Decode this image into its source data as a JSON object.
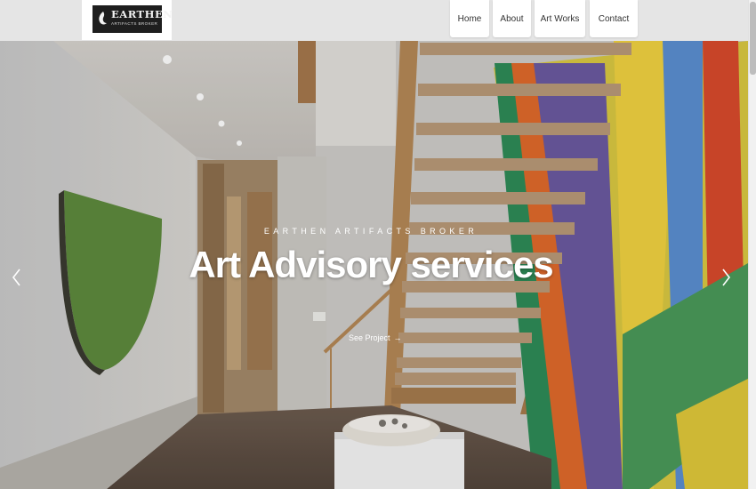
{
  "brand": {
    "logo_title": "EARTHEN",
    "logo_subtitle": "ARTIFACTS BROKER"
  },
  "nav": {
    "items": [
      {
        "label": "Home"
      },
      {
        "label": "About"
      },
      {
        "label": "Art Works"
      },
      {
        "label": "Contact"
      }
    ]
  },
  "hero": {
    "kicker": "EARTHEN ARTIFACTS BROKER",
    "title": "Art Advisory services",
    "cta_label": "See Project",
    "cta_icon": "arrow-right-icon",
    "prev_icon": "chevron-left-icon",
    "next_icon": "chevron-right-icon"
  }
}
